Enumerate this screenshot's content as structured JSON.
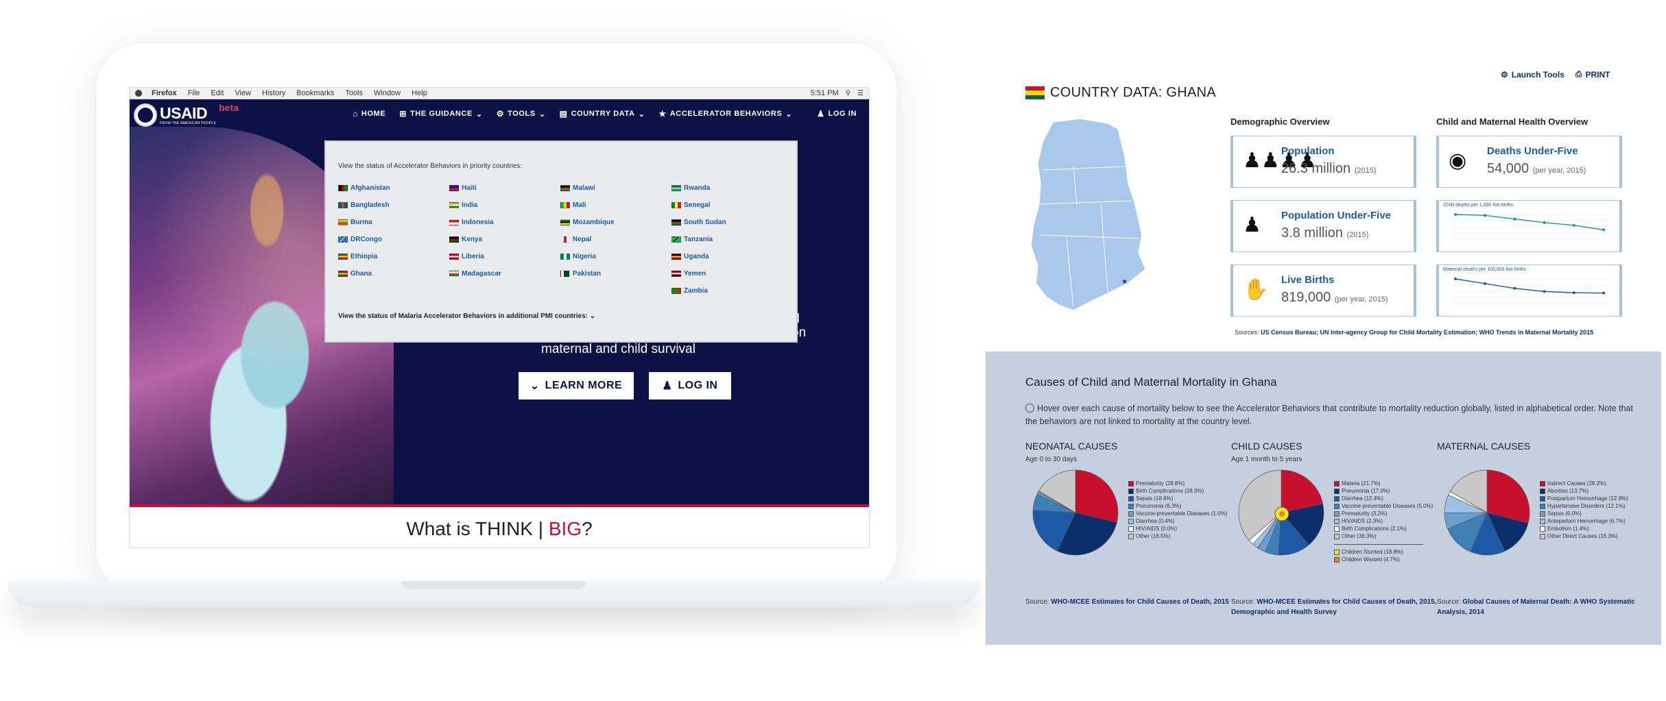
{
  "mac": {
    "app": "Firefox",
    "menu": [
      "File",
      "Edit",
      "View",
      "History",
      "Bookmarks",
      "Tools",
      "Window",
      "Help"
    ],
    "clock": "5:51 PM"
  },
  "site": {
    "logo_text": "USAID",
    "logo_tagline": "FROM THE AMERICAN PEOPLE",
    "logo_beta": "beta",
    "nav": {
      "home": "HOME",
      "guidance": "THE GUIDANCE",
      "tools": "TOOLS",
      "country_data": "COUNTRY DATA",
      "accelerator": "ACCELERATOR BEHAVIORS",
      "login": "LOG IN"
    },
    "dropdown": {
      "intro": "View the status of Accelerator Behaviors in priority countries:",
      "more": "View the status of Malaria Accelerator Behaviors in additional PMI countries:",
      "countries": [
        {
          "name": "Afghanistan",
          "colors": [
            "#000000",
            "#be0000",
            "#009900"
          ],
          "dir": "v"
        },
        {
          "name": "Bangladesh",
          "colors": [
            "#006a4e",
            "#f42a41",
            "#006a4e"
          ],
          "dir": "v"
        },
        {
          "name": "Burma",
          "colors": [
            "#fecb00",
            "#34b233",
            "#ea2839"
          ],
          "dir": "h"
        },
        {
          "name": "DRCongo",
          "colors": [
            "#007fff",
            "#f7d618",
            "#ce1021"
          ],
          "dir": "d"
        },
        {
          "name": "Ethiopia",
          "colors": [
            "#078930",
            "#fcdd09",
            "#da121a"
          ],
          "dir": "h"
        },
        {
          "name": "Ghana",
          "colors": [
            "#ce1126",
            "#fcd116",
            "#006b3f"
          ],
          "dir": "h"
        },
        {
          "name": "",
          "colors": [],
          "dir": ""
        },
        {
          "name": "Haiti",
          "colors": [
            "#00209f",
            "#d21034"
          ],
          "dir": "h"
        },
        {
          "name": "India",
          "colors": [
            "#ff9933",
            "#ffffff",
            "#138808"
          ],
          "dir": "h"
        },
        {
          "name": "Indonesia",
          "colors": [
            "#ce1126",
            "#ffffff"
          ],
          "dir": "h"
        },
        {
          "name": "Kenya",
          "colors": [
            "#000000",
            "#bb0000",
            "#006600"
          ],
          "dir": "h"
        },
        {
          "name": "Liberia",
          "colors": [
            "#bf0a30",
            "#ffffff",
            "#bf0a30"
          ],
          "dir": "h"
        },
        {
          "name": "Madagascar",
          "colors": [
            "#ffffff",
            "#fc3d32",
            "#007e3a"
          ],
          "dir": "h"
        },
        {
          "name": "",
          "colors": [],
          "dir": ""
        },
        {
          "name": "Malawi",
          "colors": [
            "#000000",
            "#ce1126",
            "#339e35"
          ],
          "dir": "h"
        },
        {
          "name": "Mali",
          "colors": [
            "#14b53a",
            "#fcd116",
            "#ce1126"
          ],
          "dir": "v"
        },
        {
          "name": "Mozambique",
          "colors": [
            "#007168",
            "#000000",
            "#fce100"
          ],
          "dir": "h"
        },
        {
          "name": "Nepal",
          "colors": [
            "#ffffff",
            "#dc143c",
            "#ffffff"
          ],
          "dir": "v"
        },
        {
          "name": "Nigeria",
          "colors": [
            "#008751",
            "#ffffff",
            "#008751"
          ],
          "dir": "v"
        },
        {
          "name": "Pakistan",
          "colors": [
            "#ffffff",
            "#01411c",
            "#01411c"
          ],
          "dir": "v"
        },
        {
          "name": "",
          "colors": [],
          "dir": ""
        },
        {
          "name": "Rwanda",
          "colors": [
            "#20603d",
            "#fad201",
            "#00a1de"
          ],
          "dir": "h"
        },
        {
          "name": "Senegal",
          "colors": [
            "#00853f",
            "#fdef42",
            "#e31b23"
          ],
          "dir": "v"
        },
        {
          "name": "South Sudan",
          "colors": [
            "#000000",
            "#da121a",
            "#078930"
          ],
          "dir": "h"
        },
        {
          "name": "Tanzania",
          "colors": [
            "#1eb53a",
            "#000000",
            "#00a3dd"
          ],
          "dir": "d"
        },
        {
          "name": "Uganda",
          "colors": [
            "#000000",
            "#fcdc04",
            "#d90000"
          ],
          "dir": "h"
        },
        {
          "name": "Yemen",
          "colors": [
            "#ce1126",
            "#ffffff",
            "#000000"
          ],
          "dir": "h"
        },
        {
          "name": "Zambia",
          "colors": [
            "#198a00",
            "#198a00",
            "#de2010"
          ],
          "dir": "v"
        }
      ]
    },
    "hero": {
      "frag1": "al",
      "frag2": "ct on",
      "line": "maternal and child survival",
      "learn_more": "LEARN MORE",
      "login": "LOG IN"
    },
    "what": {
      "prefix": "What is THINK | ",
      "big": "BIG",
      "suffix": "?"
    }
  },
  "country": {
    "title": "COUNTRY DATA: GHANA",
    "launch_tools": "Launch Tools",
    "print": "PRINT",
    "demographic_head": "Demographic Overview",
    "health_head": "Child and Maternal Health Overview",
    "stats": [
      {
        "label": "Population",
        "value": "26.3 million",
        "note": "(2015)",
        "icon": "family-icon"
      },
      {
        "label": "Population Under-Five",
        "value": "3.8 million",
        "note": "(2015)",
        "icon": "child-icon"
      },
      {
        "label": "Live Births",
        "value": "819,000",
        "note": "(per year, 2015)",
        "icon": "birth-hand-icon"
      }
    ],
    "deaths": {
      "label": "Deaths Under-Five",
      "value": "54,000",
      "note": "(per year, 2015)",
      "icon": "heartbeat-icon"
    },
    "child_chart": {
      "title": "Child deaths per 1,000 live births",
      "values": [
        61,
        60,
        56,
        52,
        49,
        44
      ]
    },
    "maternal_chart": {
      "title": "Maternal deaths per 100,000 live births",
      "values": [
        380,
        350,
        320,
        300,
        292,
        290
      ]
    },
    "sources_prefix": "Sources: ",
    "sources": "US Census Bureau; UN Inter-agency Group for Child Mortality Estimation; WHO Trends in Maternal Mortality 2015"
  },
  "causes": {
    "title": "Causes of Child and Maternal Mortality in Ghana",
    "note": "Hover over each cause of mortality below to see the Accelerator Behaviors that contribute to mortality reduction globally, listed in alphabetical order. Note that the behaviors are not linked to mortality at the country level.",
    "source_prefix": "Source: ",
    "neonatal": {
      "head": "NEONATAL CAUSES",
      "sub": "Age 0 to 30 days",
      "source": "WHO-MCEE Estimates for Child Causes of Death, 2015",
      "slices": [
        {
          "label": "Prematurity (28.8%)",
          "value": 28.8,
          "color": "#c8102e"
        },
        {
          "label": "Birth Complications (28.3%)",
          "value": 28.3,
          "color": "#0c2f6b"
        },
        {
          "label": "Sepsis (18.8%)",
          "value": 18.8,
          "color": "#1c5aa6"
        },
        {
          "label": "Pneumonia (6.3%)",
          "value": 6.3,
          "color": "#3d7fb7"
        },
        {
          "label": "Vaccine-preventable Diseases (1.0%)",
          "value": 1.0,
          "color": "#6a9fd0"
        },
        {
          "label": "Diarrhea (0.4%)",
          "value": 0.4,
          "color": "#9fc2e4"
        },
        {
          "label": "HIV/AIDS (0.0%)",
          "value": 0.0,
          "color": "#ffffff"
        },
        {
          "label": "Other (16.5%)",
          "value": 16.5,
          "color": "#c8c8c8"
        }
      ]
    },
    "child": {
      "head": "CHILD CAUSES",
      "sub": "Age 1 month to 5 years",
      "source": "WHO-MCEE Estimates for Child Causes of Death, 2015, Demographic and Health Survey",
      "slices": [
        {
          "label": "Malaria (21.7%)",
          "value": 21.7,
          "color": "#c8102e"
        },
        {
          "label": "Pneumonia (17.0%)",
          "value": 17.0,
          "color": "#0c2f6b"
        },
        {
          "label": "Diarrhea (12.4%)",
          "value": 12.4,
          "color": "#1c5aa6"
        },
        {
          "label": "Vaccine-preventable Diseases (5.0%)",
          "value": 5.0,
          "color": "#3d7fb7"
        },
        {
          "label": "Prematurity (3.2%)",
          "value": 3.2,
          "color": "#6a9fd0"
        },
        {
          "label": "HIV/AIDS (2.3%)",
          "value": 2.3,
          "color": "#9fc2e4"
        },
        {
          "label": "Birth Complications (2.1%)",
          "value": 2.1,
          "color": "#ffffff"
        },
        {
          "label": "Other (36.3%)",
          "value": 36.3,
          "color": "#c8c8c8"
        }
      ],
      "extra": [
        {
          "label": "Children Stunted (18.8%)",
          "color": "#f2e22a"
        },
        {
          "label": "Children Wasted (4.7%)",
          "color": "#e08a17"
        }
      ]
    },
    "maternal": {
      "head": "MATERNAL CAUSES",
      "sub": "",
      "source": "Global Causes of Maternal Death: A WHO Systematic Analysis, 2014",
      "slices": [
        {
          "label": "Indirect Causes (28.2%)",
          "value": 28.2,
          "color": "#c8102e"
        },
        {
          "label": "Abortion (13.7%)",
          "value": 13.7,
          "color": "#0c2f6b"
        },
        {
          "label": "Postpartum Hemorrhage (12.9%)",
          "value": 12.9,
          "color": "#1c5aa6"
        },
        {
          "label": "Hypertensive Disorders (12.1%)",
          "value": 12.1,
          "color": "#3d7fb7"
        },
        {
          "label": "Sepsis (6.0%)",
          "value": 6.0,
          "color": "#6a9fd0"
        },
        {
          "label": "Antepartum Hemorrhage (6.7%)",
          "value": 6.7,
          "color": "#9fc2e4"
        },
        {
          "label": "Embolism (1.4%)",
          "value": 1.4,
          "color": "#ffffff"
        },
        {
          "label": "Other Direct Causes (16.3%)",
          "value": 16.3,
          "color": "#c8c8c8"
        }
      ]
    }
  }
}
